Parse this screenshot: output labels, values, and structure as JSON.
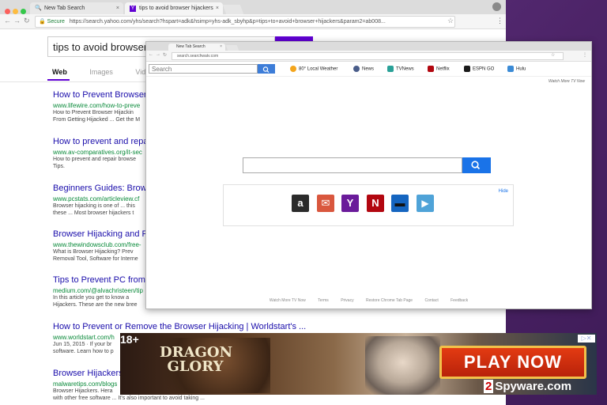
{
  "back_browser": {
    "tabs": [
      {
        "label": "New Tab Search"
      },
      {
        "label": "tips to avoid browser hijackers"
      }
    ],
    "tab_close": "×",
    "url_prefix": "Secure",
    "url": "https://search.yahoo.com/yhs/search?hspart=adk&hsimp=yhs-adk_sbyhp&p=tips+to+avoid+browser+hijackers&param2=ab008...",
    "search_query": "tips to avoid browser hija",
    "search_tabs": [
      "Web",
      "Images",
      "Video"
    ],
    "results": [
      {
        "title": "How to Prevent Browser",
        "url": "www.lifewire.com/how-to-preve",
        "desc1": "How to Prevent Browser Hijackin",
        "desc2": "From Getting Hijacked ... Get the M"
      },
      {
        "title": "How to prevent and repa",
        "url": "www.av-comparatives.org/it-sec",
        "desc1": "How to prevent and repair browse",
        "desc2": "Tips."
      },
      {
        "title": "Beginners Guides: Brows",
        "url": "www.pcstats.com/articleview.cf",
        "desc1": "Browser hijacking is one of ... this",
        "desc2": "these ... Most browser hijackers t"
      },
      {
        "title": "Browser Hijacking and Fr",
        "url": "www.thewindowsclub.com/free-",
        "desc1": "What is Browser Hijacking? Prev",
        "desc2": "Removal Tool, Software for Interne"
      },
      {
        "title": "Tips to Prevent PC from A",
        "url": "medium.com/@alvachristeen/tip",
        "desc1": "In this article you get to know a",
        "desc2": "Hijackers. These are the new bree"
      },
      {
        "title": "How to Prevent or Remove the Browser Hijacking | Worldstart's ...",
        "url": "www.worldstart.com/h",
        "desc1": "Jun 15, 2015 · If your br",
        "desc2": "software. Learn how to p"
      },
      {
        "title": "Browser Hijackers",
        "url": "malwaretips.com/blogs",
        "desc1": "Browser Hijackers. Hera",
        "desc2": "with other free software ... It's also important to avoid taking ..."
      }
    ]
  },
  "front_browser": {
    "tab_label": "New Tab Search",
    "tab_close": "×",
    "url": "search.searchwatv.com",
    "search_placeholder": "Search",
    "toolbar_links": [
      {
        "label": "80° Local Weather",
        "icon": "weather-icon",
        "color": "#f4a51c"
      },
      {
        "label": "News",
        "icon": "news-icon",
        "color": "#4a5d8a"
      },
      {
        "label": "TVNews",
        "icon": "tvnews-icon",
        "color": "#2aa198"
      },
      {
        "label": "Netflix",
        "icon": "netflix-icon",
        "color": "#b20710"
      },
      {
        "label": "ESPN GO",
        "icon": "espn-icon",
        "color": "#1a1a1a"
      },
      {
        "label": "Hulu",
        "icon": "hulu-icon",
        "color": "#3b8bd6"
      }
    ],
    "watch_more_top": "Watch More TV Now",
    "hide_label": "Hide",
    "tiles": [
      {
        "name": "amazon",
        "icon": "amazon-icon",
        "color": "#2b2b2b",
        "glyph": "a"
      },
      {
        "name": "gmail",
        "icon": "mail-icon",
        "color": "#d9573e",
        "glyph": "✉"
      },
      {
        "name": "yahoo",
        "icon": "yahoo-icon",
        "color": "#6a1b9a",
        "glyph": "Y"
      },
      {
        "name": "netflix",
        "icon": "netflix-icon",
        "color": "#b20710",
        "glyph": "N"
      },
      {
        "name": "tv",
        "icon": "tv-icon",
        "color": "#1565c0",
        "glyph": "▬"
      },
      {
        "name": "video",
        "icon": "video-icon",
        "color": "#4fa3d8",
        "glyph": "▶"
      }
    ],
    "footer_links": [
      "Watch More TV Now",
      "Terms",
      "Privacy",
      "Restore Chrome Tab Page",
      "Contact",
      "Feedback"
    ]
  },
  "ad": {
    "age_badge": "18+",
    "logo_line1": "DRAGON",
    "logo_line2": "GLORY",
    "cta": "PLAY NOW"
  },
  "watermark": {
    "number": "2",
    "text": "Spyware.com"
  }
}
